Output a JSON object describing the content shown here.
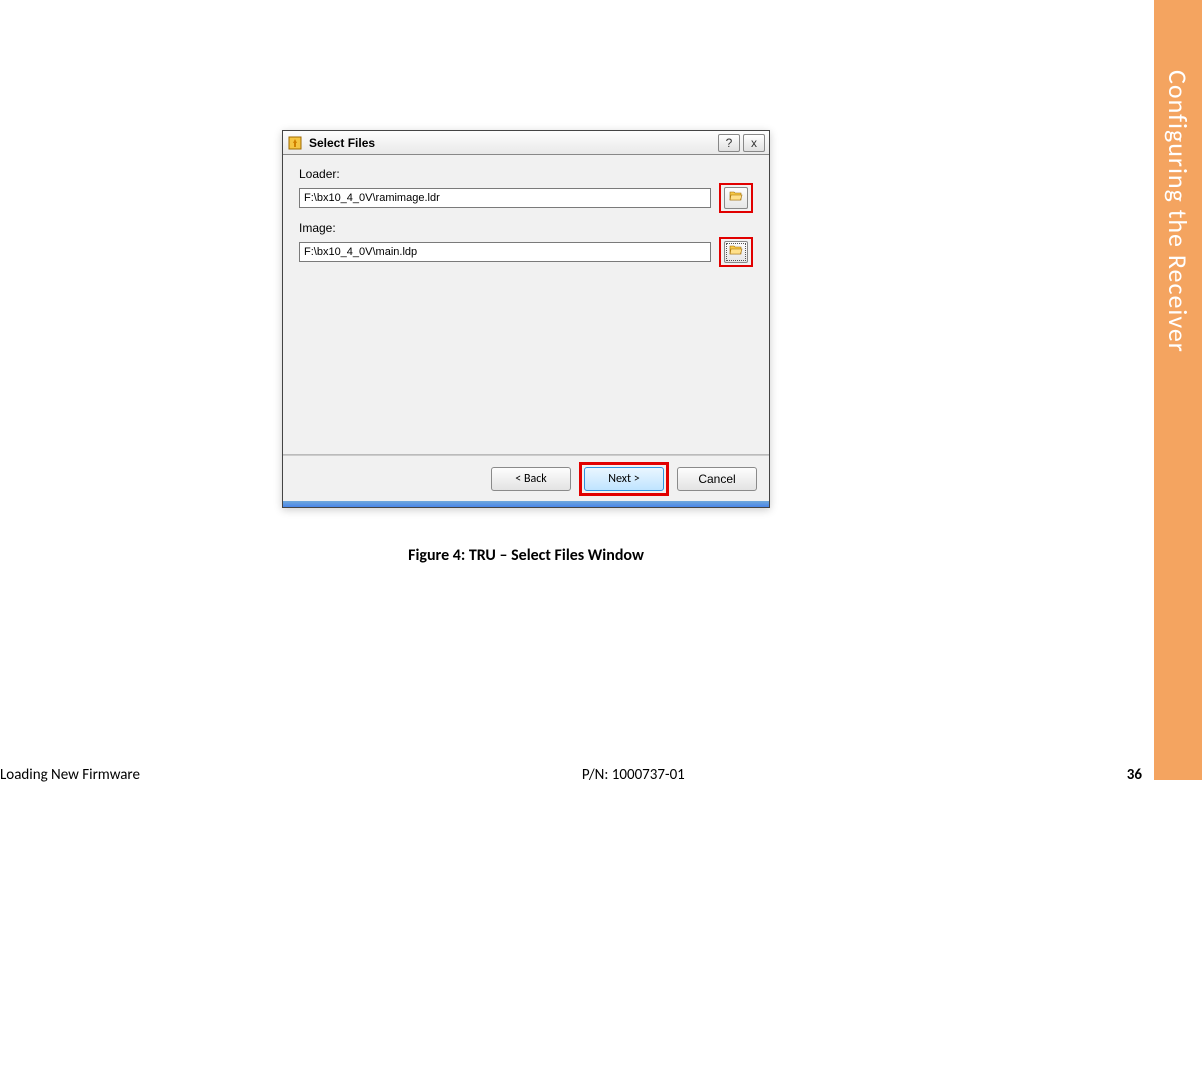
{
  "sidebar": {
    "chapter_title": "Configuring the Receiver"
  },
  "dialog": {
    "title": "Select Files",
    "help_symbol": "?",
    "close_symbol": "x",
    "loader_label": "Loader:",
    "loader_value": "F:\\bx10_4_0V\\ramimage.ldr",
    "image_label": "Image:",
    "image_value": "F:\\bx10_4_0V\\main.ldp",
    "back_label": "< Back",
    "next_label": "Next >",
    "cancel_label": "Cancel"
  },
  "caption": "Figure 4: TRU – Select Files Window",
  "footer": {
    "section": "Loading New Firmware",
    "part_number": "P/N: 1000737-01",
    "page": "36"
  },
  "colors": {
    "side_tab": "#f4a460",
    "highlight_red": "#e10000",
    "next_button_blue": "#bfe4ff"
  }
}
